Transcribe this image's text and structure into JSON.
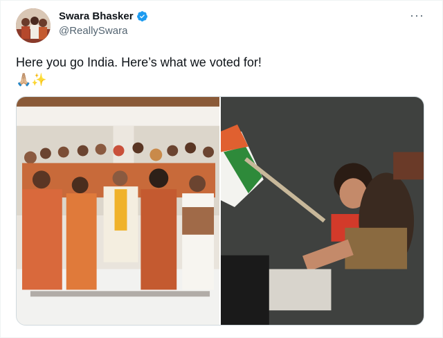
{
  "author": {
    "display_name": "Swara Bhasker",
    "handle": "@ReallySwara",
    "verified": true,
    "verified_color": "#1d9bf0",
    "avatar_icon": "profile-photo"
  },
  "menu": {
    "more_icon": "ellipsis-icon",
    "more_label": "···"
  },
  "tweet": {
    "text": "Here you go India. Here’s what we voted for!",
    "emojis": "🙏🏼✨"
  },
  "media": {
    "count": 2,
    "photos": [
      {
        "icon": "group-photo"
      },
      {
        "icon": "protest-photo"
      }
    ]
  }
}
